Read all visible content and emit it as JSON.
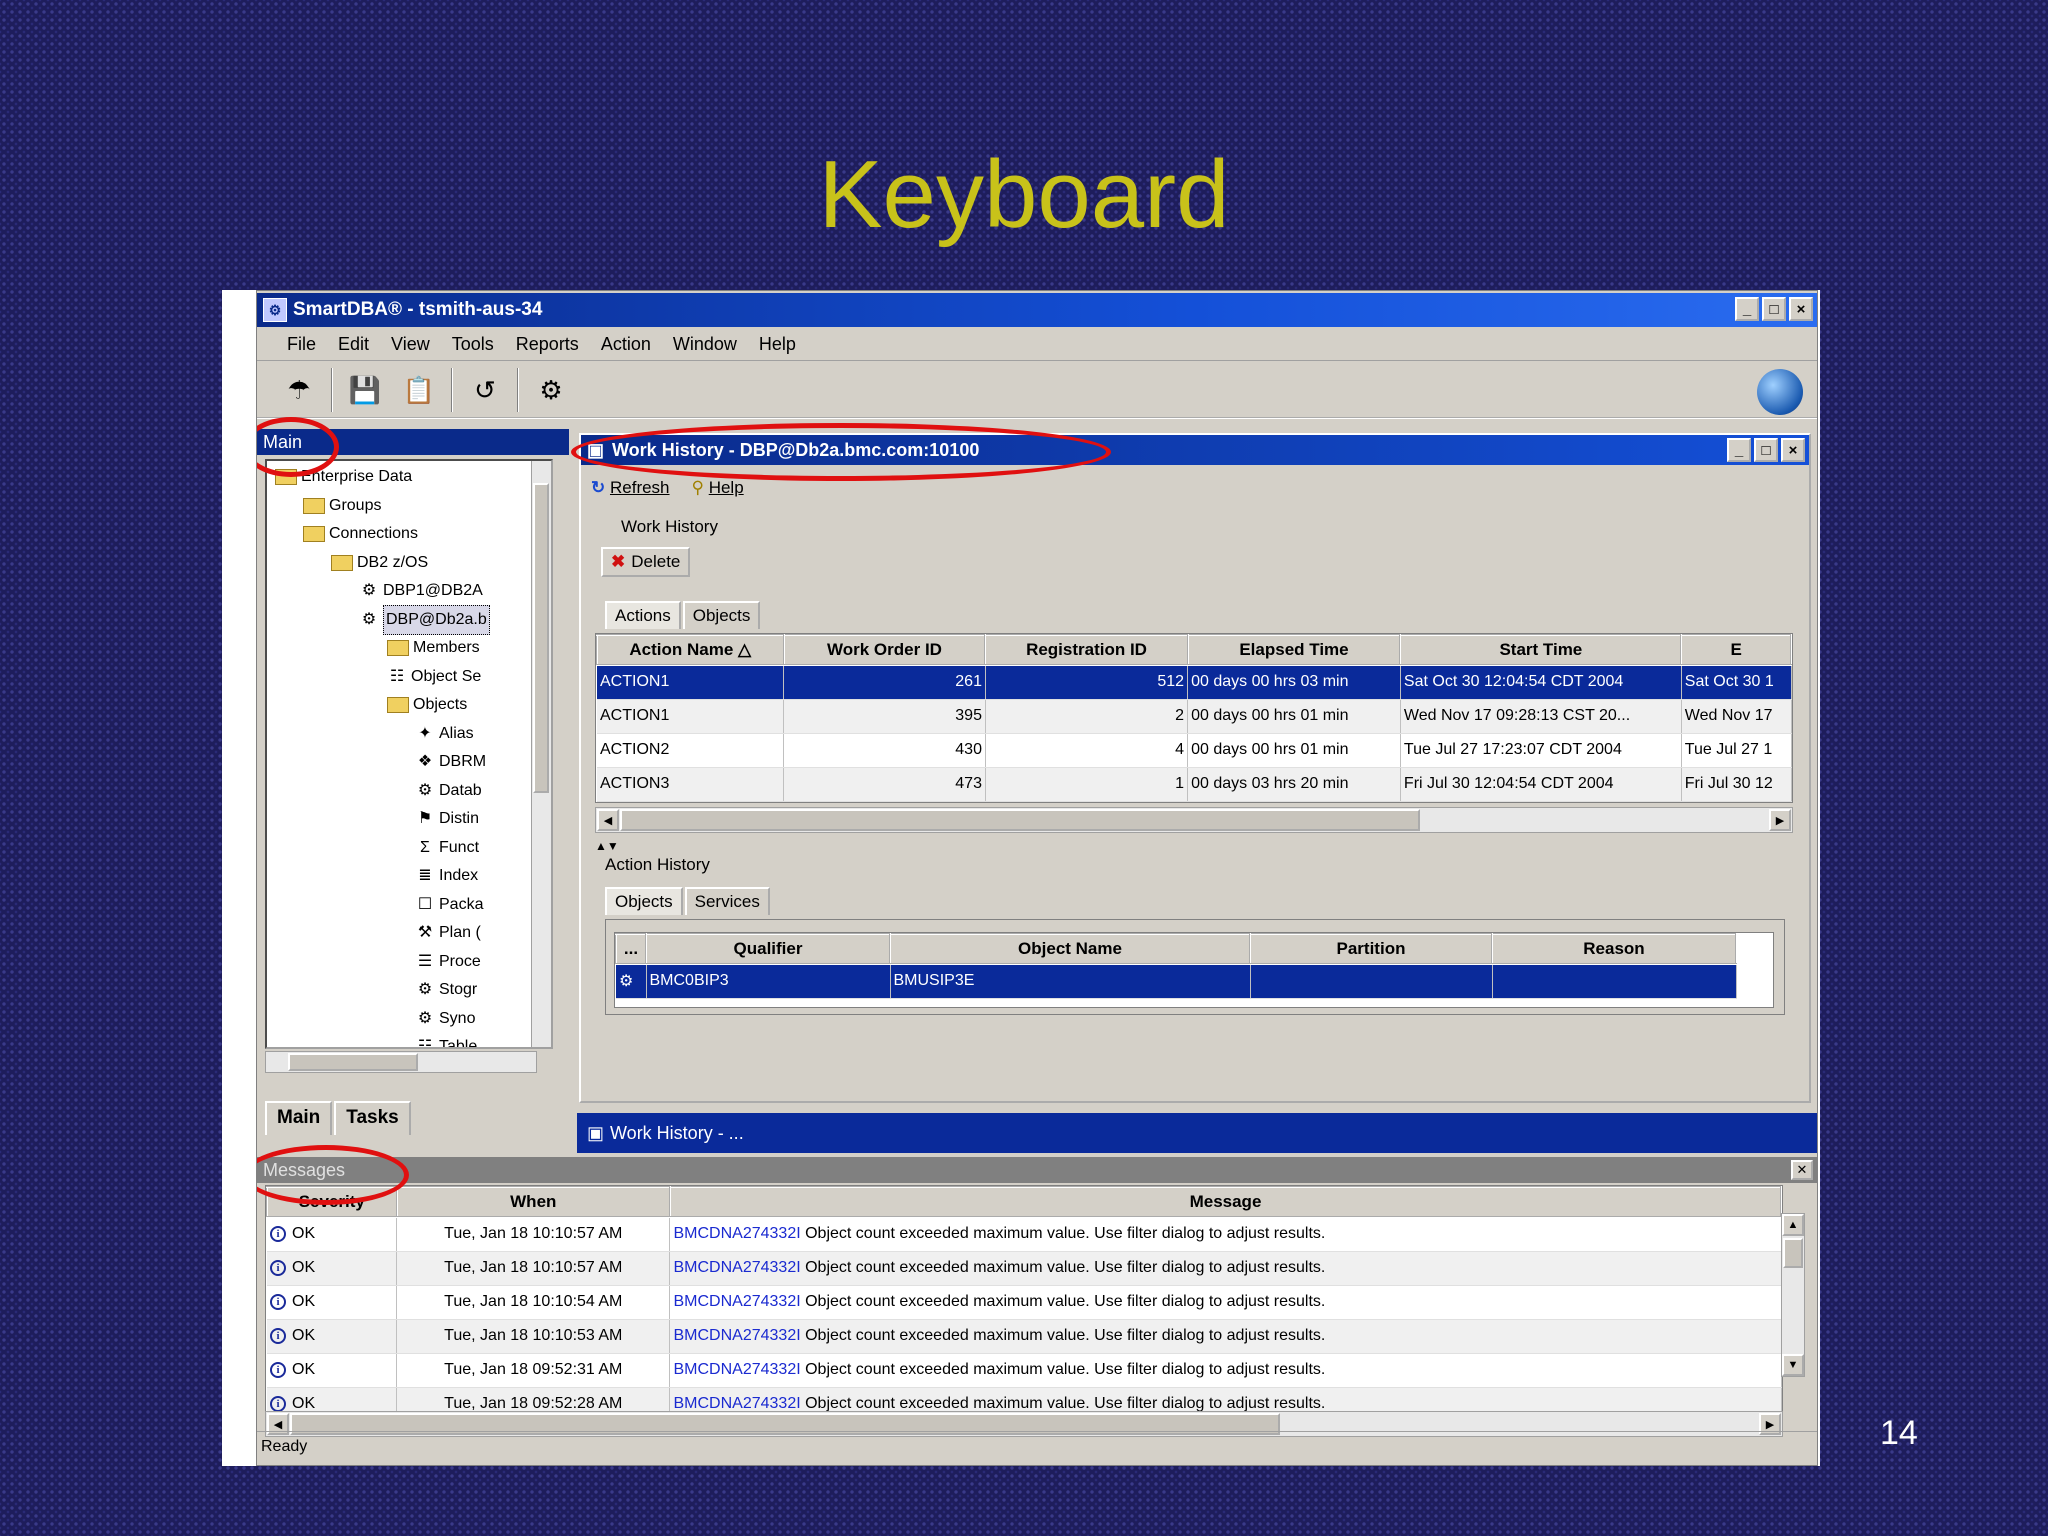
{
  "slide": {
    "title": "Keyboard",
    "page_number": "14"
  },
  "window": {
    "title": "SmartDBA® - tsmith-aus-34",
    "menu": [
      "File",
      "Edit",
      "View",
      "Tools",
      "Reports",
      "Action",
      "Window",
      "Help"
    ],
    "min": "_",
    "max": "□",
    "close": "×"
  },
  "left_pane": {
    "title": "Main",
    "tree": [
      {
        "label": "Enterprise Data",
        "level": 0,
        "icon": "folder-icon"
      },
      {
        "label": "Groups",
        "level": 1,
        "icon": "folder-icon"
      },
      {
        "label": "Connections",
        "level": 1,
        "icon": "folder-icon"
      },
      {
        "label": "DB2 z/OS",
        "level": 2,
        "icon": "folder-icon"
      },
      {
        "label": "DBP1@DB2A",
        "level": 3,
        "icon": "database-icon"
      },
      {
        "label": "DBP@Db2a.b",
        "level": 3,
        "icon": "database-icon",
        "selected": true
      },
      {
        "label": "Members",
        "level": 4,
        "icon": "folder-icon"
      },
      {
        "label": "Object Se",
        "level": 4,
        "icon": "object-icon"
      },
      {
        "label": "Objects",
        "level": 4,
        "icon": "folder-icon"
      },
      {
        "label": "Alias",
        "level": 5,
        "icon": "alias-icon"
      },
      {
        "label": "DBRM",
        "level": 5,
        "icon": "dbrm-icon"
      },
      {
        "label": "Datab",
        "level": 5,
        "icon": "database-icon"
      },
      {
        "label": "Distin",
        "level": 5,
        "icon": "distinct-icon"
      },
      {
        "label": "Funct",
        "level": 5,
        "icon": "sigma-icon"
      },
      {
        "label": "Index",
        "level": 5,
        "icon": "index-icon"
      },
      {
        "label": "Packa",
        "level": 5,
        "icon": "package-icon"
      },
      {
        "label": "Plan (",
        "level": 5,
        "icon": "plan-icon"
      },
      {
        "label": "Proce",
        "level": 5,
        "icon": "procedure-icon"
      },
      {
        "label": "Stogr",
        "level": 5,
        "icon": "storage-icon"
      },
      {
        "label": "Syno",
        "level": 5,
        "icon": "synonym-icon"
      },
      {
        "label": "Table",
        "level": 5,
        "icon": "table-icon"
      }
    ],
    "tabs": [
      "Main",
      "Tasks"
    ]
  },
  "work_history": {
    "title": "Work History - DBP@Db2a.bmc.com:10100",
    "toolbar": {
      "refresh": "Refresh",
      "help": "Help"
    },
    "group_label": "Work History",
    "delete_label": "Delete",
    "tabs": [
      "Actions",
      "Objects"
    ],
    "columns": [
      "Action Name △",
      "Work Order ID",
      "Registration ID",
      "Elapsed Time",
      "Start Time",
      "E"
    ],
    "rows": [
      [
        "ACTION1",
        "261",
        "512",
        "00 days 00 hrs 03 min",
        "Sat Oct 30 12:04:54 CDT 2004",
        "Sat Oct 30 1"
      ],
      [
        "ACTION1",
        "395",
        "2",
        "00 days 00 hrs 01 min",
        "Wed Nov 17 09:28:13 CST 20...",
        "Wed Nov 17"
      ],
      [
        "ACTION2",
        "430",
        "4",
        "00 days 00 hrs 01 min",
        "Tue Jul 27 17:23:07 CDT 2004",
        "Tue Jul 27 1"
      ],
      [
        "ACTION3",
        "473",
        "1",
        "00 days 03 hrs 20 min",
        "Fri Jul 30 12:04:54 CDT 2004",
        "Fri Jul 30 12"
      ]
    ],
    "action_history_label": "Action History",
    "ah_tabs": [
      "Objects",
      "Services"
    ],
    "ah_columns": [
      "...",
      "Qualifier",
      "Object Name",
      "Partition",
      "Reason"
    ],
    "ah_rows": [
      [
        "",
        "BMC0BIP3",
        "BMUSIP3E",
        "",
        ""
      ]
    ],
    "taskbar_label": "Work History - ..."
  },
  "messages": {
    "title": "Messages",
    "columns": [
      "Severity",
      "When",
      "Message"
    ],
    "rows": [
      {
        "severity": "OK",
        "when": "Tue, Jan 18 10:10:57 AM",
        "code": "BMCDNA274332I",
        "text": "Object count exceeded maximum value.  Use filter dialog to adjust results."
      },
      {
        "severity": "OK",
        "when": "Tue, Jan 18 10:10:57 AM",
        "code": "BMCDNA274332I",
        "text": "Object count exceeded maximum value.  Use filter dialog to adjust results."
      },
      {
        "severity": "OK",
        "when": "Tue, Jan 18 10:10:54 AM",
        "code": "BMCDNA274332I",
        "text": "Object count exceeded maximum value.  Use filter dialog to adjust results."
      },
      {
        "severity": "OK",
        "when": "Tue, Jan 18 10:10:53 AM",
        "code": "BMCDNA274332I",
        "text": "Object count exceeded maximum value.  Use filter dialog to adjust results."
      },
      {
        "severity": "OK",
        "when": "Tue, Jan 18 09:52:31 AM",
        "code": "BMCDNA274332I",
        "text": "Object count exceeded maximum value.  Use filter dialog to adjust results."
      },
      {
        "severity": "OK",
        "when": "Tue, Jan 18 09:52:28 AM",
        "code": "BMCDNA274332I",
        "text": "Object count exceeded maximum value.  Use filter dialog to adjust results."
      }
    ]
  },
  "status": {
    "text": "Ready"
  },
  "colors": {
    "accent": "#0a2a9a",
    "highlight_ring": "#e01010",
    "title_text": "#c8c21a"
  }
}
